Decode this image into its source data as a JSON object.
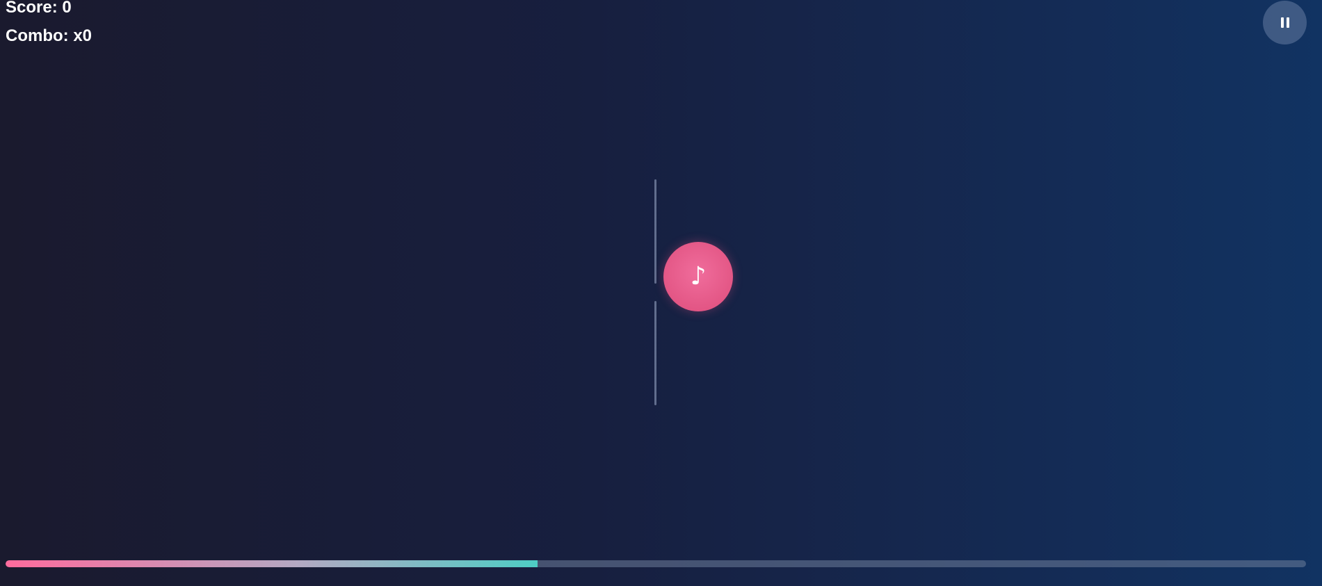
{
  "hud": {
    "score_text": "Score: 0",
    "combo_text": "Combo: x0"
  },
  "pause_button": {
    "icon": "pause-icon"
  },
  "note": {
    "icon": "music-note-icon",
    "glyph": "♪",
    "color": "#e35685"
  },
  "progress": {
    "value": 0.409,
    "fill_start_color": "#ff6b9d",
    "fill_end_color": "#4ecdc4"
  }
}
